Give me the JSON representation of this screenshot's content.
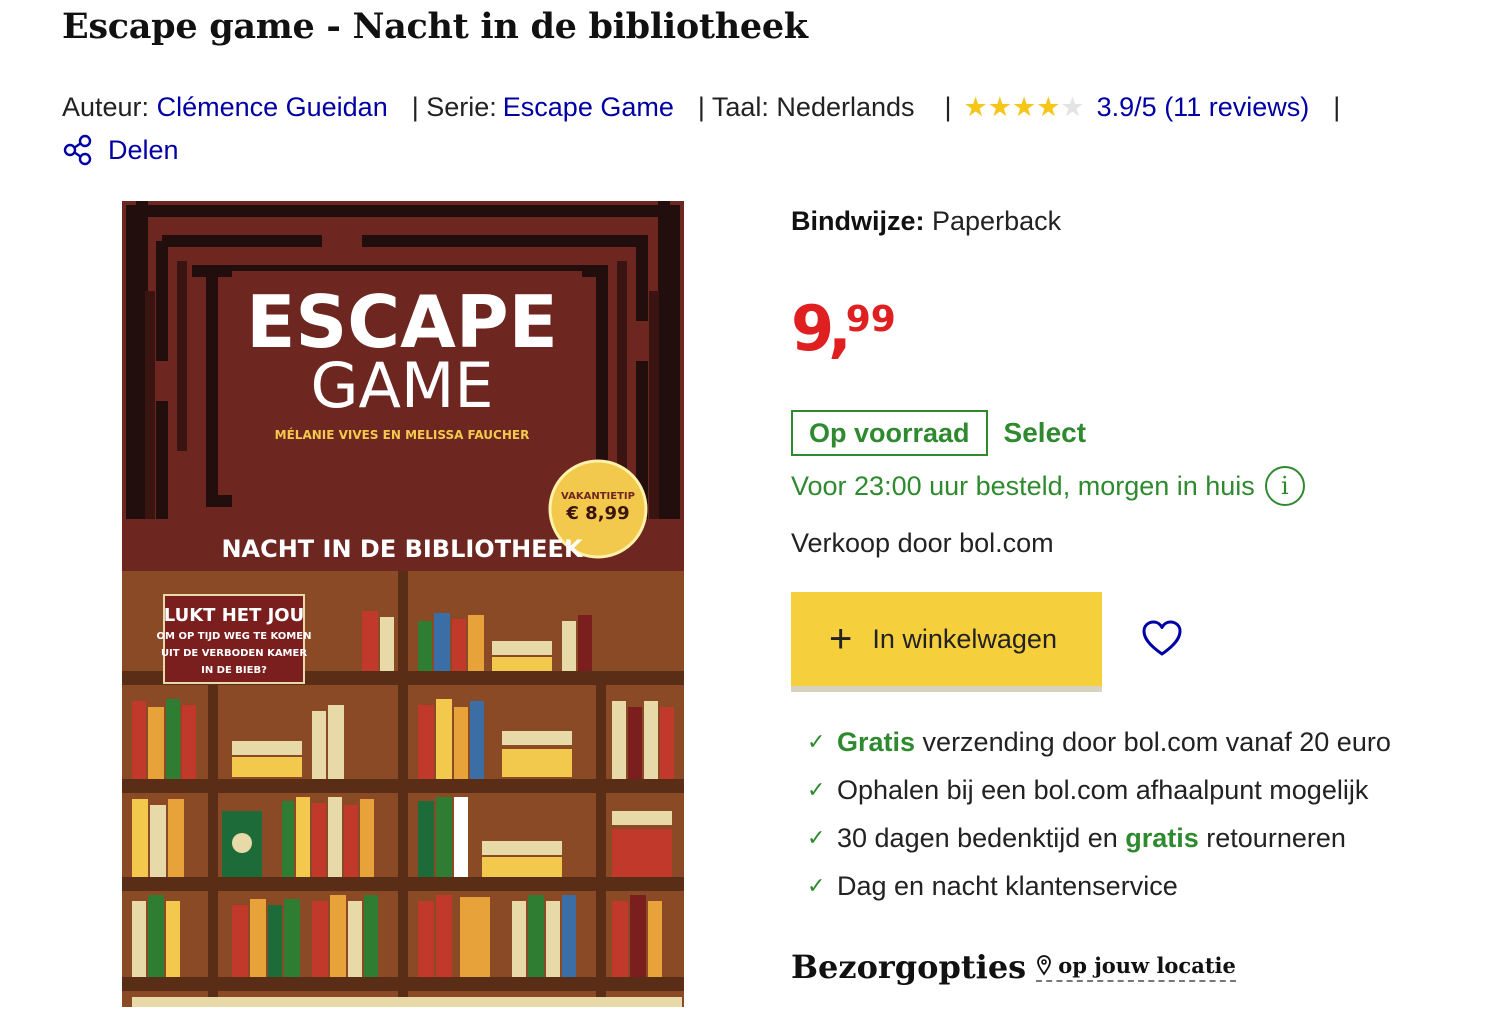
{
  "product": {
    "title": "Escape game - Nacht in de bibliotheek",
    "author_label": "Auteur:",
    "author": "Clémence Gueidan",
    "series_label": "| Serie:",
    "series": "Escape Game",
    "language": "| Taal: Nederlands",
    "rating_sep": "|",
    "rating": 3.9,
    "rating_text": "3.9/5 (11 reviews)",
    "end_sep": "|",
    "share_label": "Delen"
  },
  "cover": {
    "title_line1": "ESCAPE",
    "title_line2": "GAME",
    "authors": "MÉLANIE VIVES EN MELISSA FAUCHER",
    "badge_top": "VAKANTIETIP",
    "badge_price": "€ 8,99",
    "subtitle": "NACHT IN DE BIBLIOTHEEK",
    "sign_line1": "LUKT HET JOU",
    "sign_line2": "OM OP TIJD WEG TE KOMEN",
    "sign_line3": "UIT DE VERBODEN KAMER",
    "sign_line4": "IN DE BIEB?"
  },
  "offer": {
    "binding_label": "Bindwijze:",
    "binding_value": "Paperback",
    "price_int": "9",
    "price_comma": ",",
    "price_dec": "99",
    "stock": "Op voorraad",
    "select": "Select",
    "delivery": "Voor 23:00 uur besteld, morgen in huis",
    "info_glyph": "i",
    "seller": "Verkoop door bol.com",
    "cart_plus": "+",
    "cart_label": "In winkelwagen"
  },
  "usps": {
    "u1_bold": "Gratis",
    "u1_rest": " verzending door bol.com vanaf 20 euro",
    "u2": "Ophalen bij een bol.com afhaalpunt mogelijk",
    "u3_a": "30 dagen bedenktijd en ",
    "u3_bold": "gratis",
    "u3_b": " retourneren",
    "u4": "Dag en nacht klantenservice",
    "check": "✓"
  },
  "delivery_options": {
    "heading": "Bezorgopties",
    "location": "op jouw locatie"
  },
  "colors": {
    "link": "#0000a4",
    "green": "#2f8a2f",
    "price": "#e02020",
    "cart": "#f5cf3c"
  }
}
